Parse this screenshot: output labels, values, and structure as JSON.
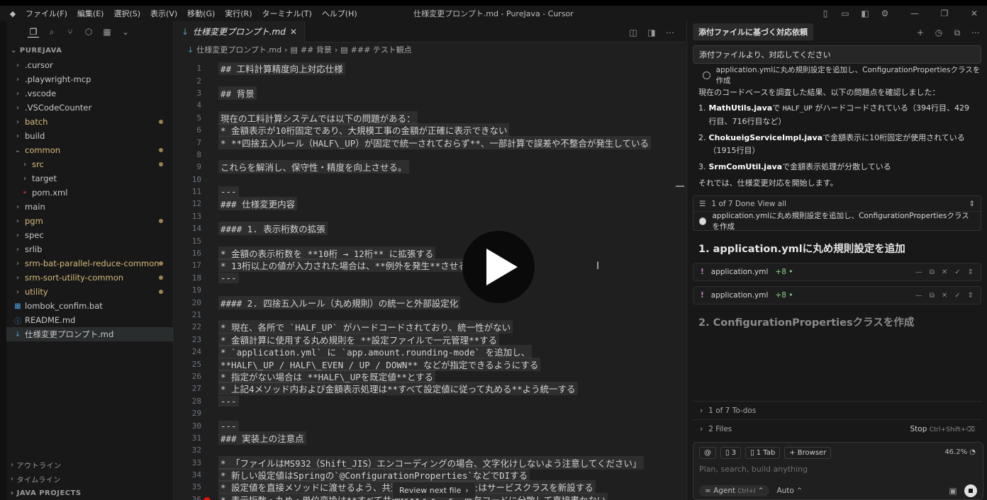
{
  "window": {
    "title": "仕様変更プロンプト.md - PureJava - Cursor"
  },
  "menu": [
    "ファイル(F)",
    "編集(E)",
    "選択(S)",
    "表示(V)",
    "移動(G)",
    "実行(R)",
    "ターミナル(T)",
    "ヘルプ(H)"
  ],
  "explorer": {
    "section": "PUREJAVA",
    "items": [
      {
        "label": ".cursor",
        "type": "folder",
        "level": 0,
        "dot": false
      },
      {
        "label": ".playwright-mcp",
        "type": "folder",
        "level": 0,
        "dot": false
      },
      {
        "label": ".vscode",
        "type": "folder",
        "level": 0,
        "dot": false
      },
      {
        "label": ".VSCodeCounter",
        "type": "folder",
        "level": 0,
        "dot": false
      },
      {
        "label": "batch",
        "type": "folder",
        "level": 0,
        "dot": true
      },
      {
        "label": "build",
        "type": "folder",
        "level": 0,
        "dot": false
      },
      {
        "label": "common",
        "type": "folder-open",
        "level": 0,
        "dot": true
      },
      {
        "label": "src",
        "type": "folder",
        "level": 1,
        "dot": true
      },
      {
        "label": "target",
        "type": "folder",
        "level": 1,
        "dot": false
      },
      {
        "label": "pom.xml",
        "type": "xml",
        "level": 1,
        "dot": false
      },
      {
        "label": "main",
        "type": "folder",
        "level": 0,
        "dot": false
      },
      {
        "label": "pgm",
        "type": "folder",
        "level": 0,
        "dot": true
      },
      {
        "label": "spec",
        "type": "folder",
        "level": 0,
        "dot": false
      },
      {
        "label": "srlib",
        "type": "folder",
        "level": 0,
        "dot": false
      },
      {
        "label": "srm-bat-parallel-reduce-common",
        "type": "folder",
        "level": 0,
        "dot": true
      },
      {
        "label": "srm-sort-utility-common",
        "type": "folder",
        "level": 0,
        "dot": true
      },
      {
        "label": "utility",
        "type": "folder",
        "level": 0,
        "dot": true
      },
      {
        "label": "lombok_confim.bat",
        "type": "bat",
        "level": 0,
        "dot": false
      },
      {
        "label": "README.md",
        "type": "info",
        "level": 0,
        "dot": false
      },
      {
        "label": "仕様変更プロンプト.md",
        "type": "md",
        "level": 0,
        "dot": false,
        "selected": true
      }
    ],
    "bottom": [
      "アウトライン",
      "タイムライン",
      "JAVA PROJECTS"
    ]
  },
  "editor": {
    "tab": "仕様変更プロンプト.md",
    "breadcrumb": [
      "仕様変更プロンプト.md",
      "## 背景",
      "### テスト観点"
    ],
    "lines": [
      {
        "n": "1",
        "t": "## 工料計算精度向上対応仕様"
      },
      {
        "n": "2",
        "t": ""
      },
      {
        "n": "3",
        "t": "## 背景"
      },
      {
        "n": "4",
        "t": ""
      },
      {
        "n": "5",
        "t": "現在の工料計算システムでは以下の問題がある："
      },
      {
        "n": "6",
        "t": "* 金額表示が10桁固定であり、大規模工事の金額が正確に表示できない"
      },
      {
        "n": "7",
        "t": "* **四捨五入ルール（HALF\\_UP）が固定で統一されておらず**、一部計算で誤差や不整合が発生している"
      },
      {
        "n": "8",
        "t": ""
      },
      {
        "n": "9",
        "t": "これらを解消し、保守性・精度を向上させる。"
      },
      {
        "n": "10",
        "t": ""
      },
      {
        "n": "11",
        "t": "---"
      },
      {
        "n": "12",
        "t": "### 仕様変更内容"
      },
      {
        "n": "13",
        "t": ""
      },
      {
        "n": "14",
        "t": "#### 1. 表示桁数の拡張"
      },
      {
        "n": "15",
        "t": ""
      },
      {
        "n": "16",
        "t": "* 金額の表示桁数を **10桁 → 12桁** に拡張する"
      },
      {
        "n": "17",
        "t": "* 13桁以上の値が入力された場合は、**例外を発生**させる"
      },
      {
        "n": "18",
        "t": "---"
      },
      {
        "n": "19",
        "t": ""
      },
      {
        "n": "20",
        "t": "#### 2. 四捨五入ルール（丸め規則）の統一と外部設定化"
      },
      {
        "n": "21",
        "t": ""
      },
      {
        "n": "22",
        "t": "* 現在、各所で `HALF_UP` がハードコードされており、統一性がない"
      },
      {
        "n": "23",
        "t": "* 金額計算に使用する丸め規則を **設定ファイルで一元管理**する"
      },
      {
        "n": "24",
        "t": "* `application.yml` に `app.amount.rounding-mode` を追加し、"
      },
      {
        "n": "25",
        "t": "**HALF\\_UP / HALF\\_EVEN / UP / DOWN** などが指定できるようにする"
      },
      {
        "n": "26",
        "t": "* 指定がない場合は **HALF\\_UPを既定値**とする"
      },
      {
        "n": "27",
        "t": "* 上記4メソッド内および金額表示処理は**すべて設定値に従って丸める**よう統一する"
      },
      {
        "n": "28",
        "t": "---"
      },
      {
        "n": "29",
        "t": ""
      },
      {
        "n": "30",
        "t": "---"
      },
      {
        "n": "31",
        "t": "### 実装上の注意点"
      },
      {
        "n": "32",
        "t": ""
      },
      {
        "n": "33",
        "t": "* 「ファイルはMS932（Shift_JIS）エンコーディングの場合、文字化けしないよう注意してください」"
      },
      {
        "n": "34",
        "t": "* 新しい設定値はSpringの`@ConfigurationProperties`などでDIする"
      },
      {
        "n": "35",
        "t": "* 設定値を直接メソッドに渡せるよう、共通ユーティリティまたはサービスクラスを新設する"
      },
      {
        "n": "36",
        "t": "* 表示桁数・丸め・単位変換は**すべて共通化**すること。既存コードに分散して直接書かない"
      }
    ],
    "review_label": "Review next file"
  },
  "chat": {
    "tab": "添付ファイルに基づく対応依頼",
    "user_message": "添付ファイルより、対応してください",
    "pending_todo": "application.ymlに丸め規則設定を追加し、ConfigurationPropertiesクラスを作成",
    "intro": "現在のコードベースを調査した結果、以下の問題点を確認しました：",
    "findings": [
      {
        "num": "1.",
        "bold": "MathUtils.java",
        "mid": "で ",
        "code": "HALF_UP",
        "rest": " がハードコードされている（394行目、429行目、716行目など）"
      },
      {
        "num": "2.",
        "bold": "ChokueigServiceImpl.java",
        "mid": "で金額表示に10桁固定が使用されている（1915行目）",
        "code": "",
        "rest": ""
      },
      {
        "num": "3.",
        "bold": "SrmComUtil.java",
        "mid": "で金額表示処理が分散している",
        "code": "",
        "rest": ""
      }
    ],
    "start": "それでは、仕様変更対応を開始します。",
    "todo_summary": "1 of 7 Done",
    "view_all": "View all",
    "todo_current": "application.ymlに丸め規則設定を追加し、ConfigurationPropertiesクラスを作成",
    "heading1": "1. application.ymlに丸め規則設定を追加",
    "files": [
      {
        "name": "application.yml",
        "diff": "+8 •"
      },
      {
        "name": "application.yml",
        "diff": "+8 •"
      }
    ],
    "heading2": "2. ConfigurationPropertiesクラスを作成",
    "todos_collapsed": "1 of 7 To-dos",
    "files_collapsed": "2 Files",
    "stop": "Stop",
    "stop_shortcut": "Ctrl+Shift+⌫",
    "composer": {
      "context_count": "3",
      "tab_pill": "1 Tab",
      "browser_pill": "Browser",
      "percent": "46.2%",
      "placeholder": "Plan, search, build anything",
      "mode": "Agent",
      "mode_shortcut": "Ctrl+I",
      "model": "Auto"
    }
  }
}
